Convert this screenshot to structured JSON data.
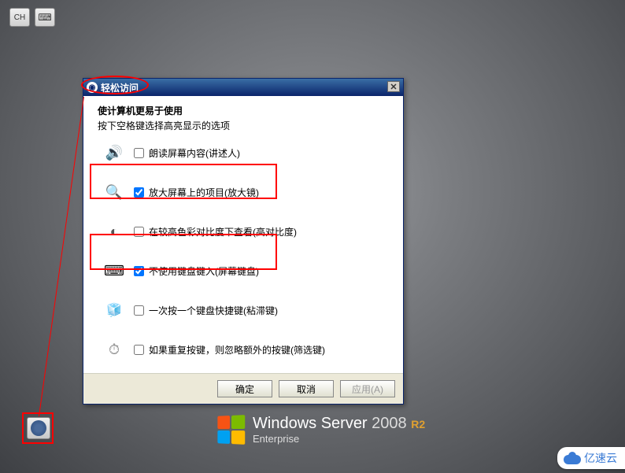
{
  "taskbar": {
    "ime_label": "CH",
    "kbd_icon_name": "keyboard-icon"
  },
  "dialog": {
    "title": "轻松访问",
    "close_label": "✕",
    "heading": "使计算机更易于使用",
    "subheading": "按下空格键选择高亮显示的选项",
    "options": [
      {
        "label": "朗读屏幕内容(讲述人)",
        "checked": false,
        "icon": "narrator"
      },
      {
        "label": "放大屏幕上的项目(放大镜)",
        "checked": true,
        "icon": "magnifier"
      },
      {
        "label": "在较高色彩对比度下查看(高对比度)",
        "checked": false,
        "icon": "contrast"
      },
      {
        "label": "不使用键盘键入(屏幕键盘)",
        "checked": true,
        "icon": "keyboard"
      },
      {
        "label": "一次按一个键盘快捷键(粘滞键)",
        "checked": false,
        "icon": "sticky"
      },
      {
        "label": "如果重复按键，则忽略额外的按键(筛选键)",
        "checked": false,
        "icon": "filter"
      }
    ],
    "buttons": {
      "ok": "确定",
      "cancel": "取消",
      "apply": "应用(A)"
    }
  },
  "branding": {
    "product": "Windows Server",
    "year": "2008",
    "suffix": "R2",
    "edition": "Enterprise"
  },
  "watermark": {
    "text": "亿速云"
  }
}
